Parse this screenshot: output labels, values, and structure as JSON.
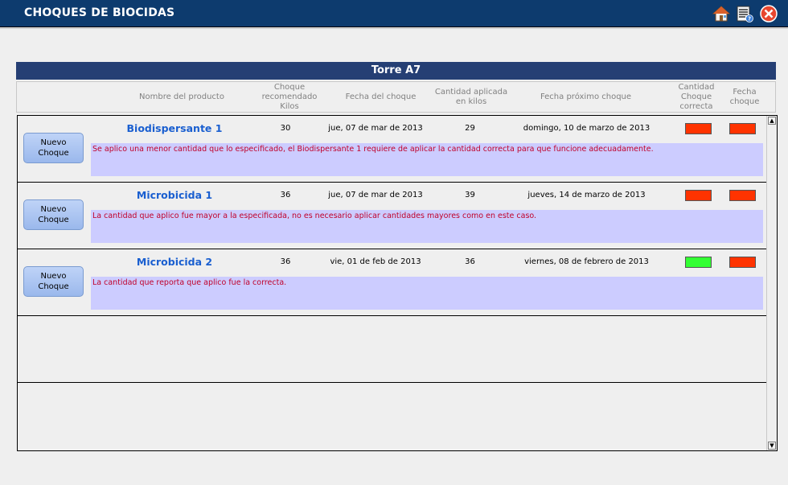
{
  "window": {
    "title": "CHOQUES DE BIOCIDAS"
  },
  "tower": {
    "name": "Torre A7"
  },
  "columns": {
    "producto": "Nombre del producto",
    "recomendado": "Choque recomendado Kilos",
    "fecha": "Fecha del choque",
    "cantidad": "Cantidad aplicada en kilos",
    "proximo": "Fecha próximo choque",
    "correcta": "Cantidad Choque correcta",
    "fecha_choque": "Fecha choque"
  },
  "button_label": "Nuevo Choque",
  "rows": [
    {
      "producto": "Biodispersante 1",
      "recomendado": "30",
      "fecha": "jue, 07 de mar de 2013",
      "cantidad": "29",
      "proximo": "domingo, 10 de marzo de 2013",
      "nota": "Se aplico una menor cantidad que lo especificado, el Biodispersante 1 requiere de aplicar la cantidad correcta para que funcione adecuadamente.",
      "ind_cantidad_color": "#ff3300",
      "ind_fecha_color": "#ff3300"
    },
    {
      "producto": "Microbicida 1",
      "recomendado": "36",
      "fecha": "jue, 07 de mar de 2013",
      "cantidad": "39",
      "proximo": "jueves, 14 de marzo de 2013",
      "nota": "La cantidad que aplico fue mayor a la especificada, no es necesario aplicar cantidades mayores como en este caso.",
      "ind_cantidad_color": "#ff3300",
      "ind_fecha_color": "#ff3300"
    },
    {
      "producto": "Microbicida 2",
      "recomendado": "36",
      "fecha": "vie, 01 de feb de 2013",
      "cantidad": "36",
      "proximo": "viernes, 08 de febrero de 2013",
      "nota": "La cantidad que reporta que aplico fue la correcta.",
      "ind_cantidad_color": "#33ff33",
      "ind_fecha_color": "#ff3300"
    }
  ],
  "icons": {
    "home": "home-icon",
    "report": "report-icon",
    "close": "close-icon"
  }
}
